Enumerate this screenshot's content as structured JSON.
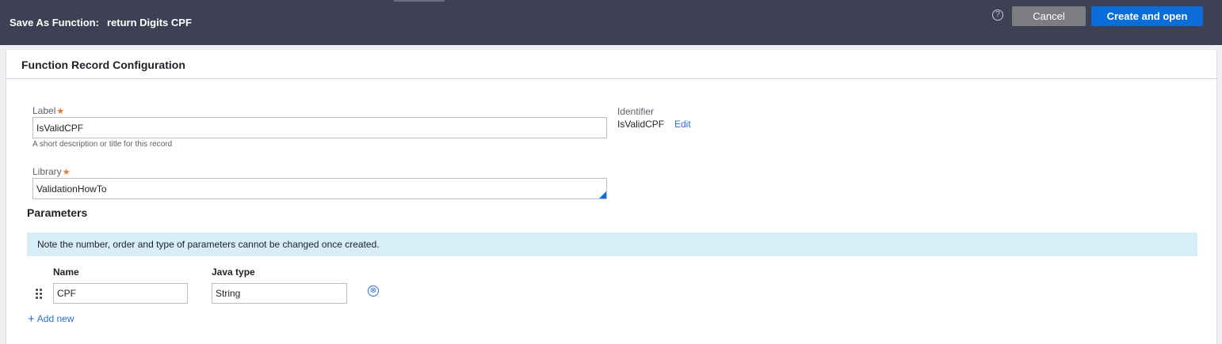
{
  "header": {
    "title_label": "Save As Function:",
    "title_value": "return Digits CPF",
    "help_icon": "?",
    "cancel_label": "Cancel",
    "create_label": "Create and open"
  },
  "panel": {
    "title": "Function Record Configuration"
  },
  "form": {
    "label_field": {
      "label": "Label",
      "value": "IsValidCPF",
      "help": "A short description or title for this record"
    },
    "library_field": {
      "label": "Library",
      "value": "ValidationHowTo"
    },
    "identifier": {
      "label": "Identifier",
      "value": "IsValidCPF",
      "edit_label": "Edit"
    },
    "required_mark": "★"
  },
  "parameters": {
    "title": "Parameters",
    "note": "Note the number, order and type of parameters cannot be changed once created.",
    "columns": {
      "name": "Name",
      "java_type": "Java type"
    },
    "rows": [
      {
        "name": "CPF",
        "java_type": "String"
      }
    ],
    "remove_icon": "⊗",
    "add_new_label": "Add new",
    "add_new_icon": "+"
  },
  "colors": {
    "header_bg": "#3e4154",
    "primary_button": "#0b6dda",
    "cancel_button": "#7b7d80",
    "info_banner": "#d7eef8",
    "link": "#2d6fd0",
    "required": "#e8762d"
  }
}
